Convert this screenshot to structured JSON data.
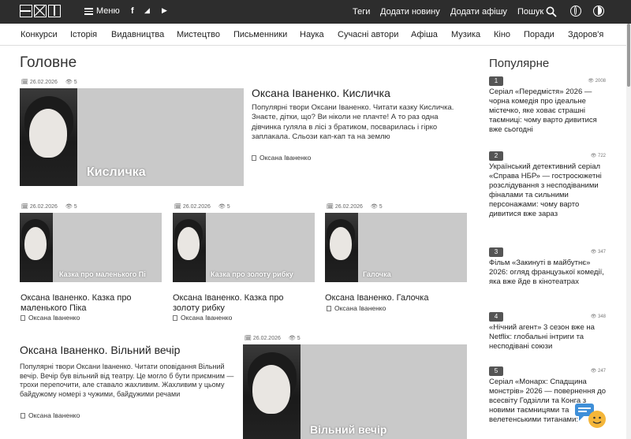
{
  "topbar": {
    "menu_label": "Меню",
    "social": [
      "f",
      "◢",
      "▶"
    ],
    "links": [
      "Теги",
      "Додати новину",
      "Додати афішу",
      "Пошук"
    ]
  },
  "nav": [
    "Конкурси",
    "Історія",
    "Видавництва",
    "Мистецтво",
    "Письменники",
    "Наука",
    "Сучасні автори",
    "Афіша",
    "Музика",
    "Кіно",
    "Поради",
    "Здоров'я"
  ],
  "main": {
    "heading": "Головне",
    "featured": {
      "date": "26.02.2026",
      "views": "5",
      "image_caption": "Кисличка",
      "title": "Оксана Іваненко. Кисличка",
      "excerpt": "Популярні твори Оксани Іваненко. Читати казку Кисличка. Знаєте, дітки, що? Ви ніколи не плачте! А то раз одна дівчинка гуляла в лісі з братиком, посварилась і гірко заплакала. Сльози кап-кап та на землю",
      "author": "Оксана Іваненко"
    },
    "grid": [
      {
        "date": "26.02.2026",
        "views": "5",
        "image_caption": "Казка про маленького Пі",
        "title": "Оксана Іваненко. Казка про маленького Піка",
        "author": "Оксана Іваненко"
      },
      {
        "date": "26.02.2026",
        "views": "5",
        "image_caption": "Казка про золоту рибку",
        "title": "Оксана Іваненко. Казка про золоту рибку",
        "author": "Оксана Іваненко"
      },
      {
        "date": "26.02.2026",
        "views": "5",
        "image_caption": "Галочка",
        "title": "Оксана Іваненко. Галочка",
        "author": "Оксана Іваненко"
      }
    ],
    "bottom": {
      "date": "26.02.2026",
      "views": "5",
      "image_caption": "Вільний вечір",
      "title": "Оксана Іваненко. Вільний вечір",
      "excerpt": "Популярні твори Оксани Іваненко. Читати оповідання Вільний вечір. Вечір був вільний від театру. Це могло б бути приємним — трохи перепочити, але ставало жахливим. Жахливим у цьому байдужому номері з чужими, байдужими речами",
      "author": "Оксана Іваненко"
    }
  },
  "sidebar": {
    "heading": "Популярне",
    "items": [
      {
        "num": "1",
        "views": "2008",
        "text": "Серіал «Передмістя» 2026 — чорна комедія про ідеальне містечко, яке ховає страшні таємниці: чому варто дивитися вже сьогодні"
      },
      {
        "num": "2",
        "views": "722",
        "text": "Український детективний серіал «Справа НБР» — гостросюжетні розслідування з несподіваними фіналами та сильними персонажами: чому варто дивитися вже зараз"
      },
      {
        "num": "3",
        "views": "347",
        "text": "Фільм «Закинуті в майбутнє» 2026: огляд французької комедії, яка вже йде в кінотеатрах"
      },
      {
        "num": "4",
        "views": "348",
        "text": "«Нічний агент» 3 сезон вже на Netflix: глобальні інтриги та несподівані союзи"
      },
      {
        "num": "5",
        "views": "247",
        "text": "Серіал «Монарх: Спадщина монстрів» 2026 — повернення до всесвіту Годзілли та Конга з новими таємницями та велетенськими титанами:"
      }
    ]
  }
}
